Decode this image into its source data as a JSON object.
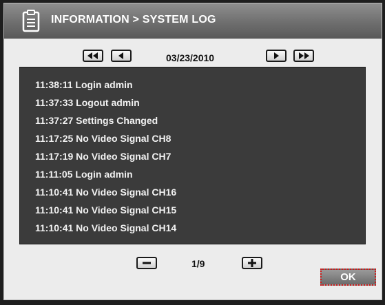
{
  "titlebar": {
    "title": "INFORMATION > SYSTEM LOG",
    "icon": "clipboard-icon"
  },
  "date_nav": {
    "date": "03/23/2010",
    "buttons": [
      "fast-rewind-icon",
      "rewind-icon",
      "forward-icon",
      "fast-forward-icon"
    ]
  },
  "log": {
    "entries": [
      "11:38:11 Login admin",
      "11:37:33 Logout admin",
      "11:37:27 Settings Changed",
      "11:17:25 No Video Signal CH8",
      "11:17:19 No Video Signal CH7",
      "11:11:05 Login admin",
      "11:10:41 No Video Signal CH16",
      "11:10:41 No Video Signal CH15",
      "11:10:41 No Video Signal CH14"
    ]
  },
  "pager": {
    "page": "1/9",
    "prev_icon": "minus-icon",
    "next_icon": "plus-icon"
  },
  "ok_label": "OK",
  "colors": {
    "titlebar": "#6f6f6f",
    "dialog_bg": "#ececec",
    "log_bg": "#3b3b3b",
    "log_text": "#f2f2f2",
    "focus_border": "#d01818"
  }
}
